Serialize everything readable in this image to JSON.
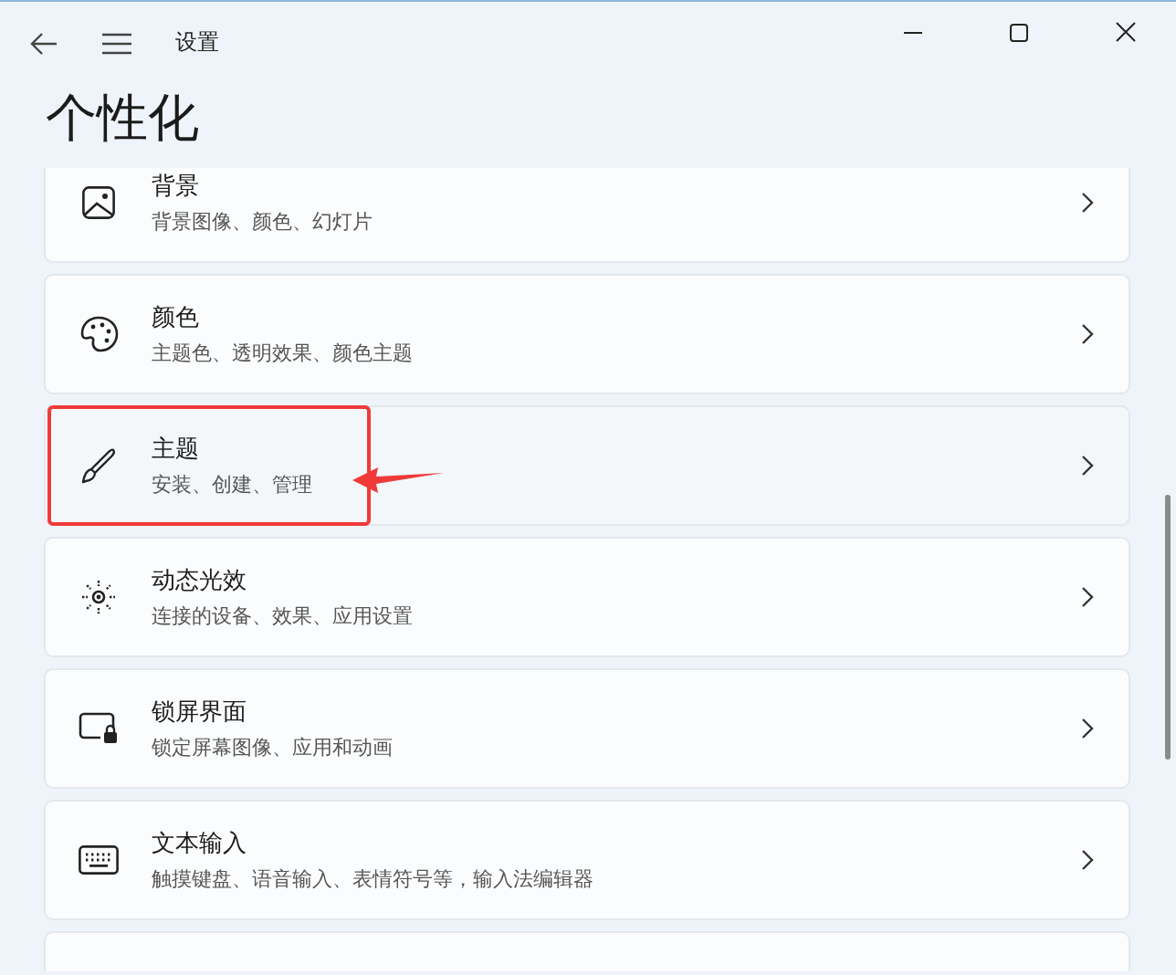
{
  "window": {
    "title": "设置"
  },
  "page_title": "个性化",
  "items": [
    {
      "kind": "picture",
      "title": "背景",
      "subtitle": "背景图像、颜色、幻灯片",
      "highlighted": false
    },
    {
      "kind": "palette",
      "title": "颜色",
      "subtitle": "主题色、透明效果、颜色主题",
      "highlighted": false
    },
    {
      "kind": "brush",
      "title": "主题",
      "subtitle": "安装、创建、管理",
      "highlighted": true
    },
    {
      "kind": "lighting",
      "title": "动态光效",
      "subtitle": "连接的设备、效果、应用设置",
      "highlighted": false
    },
    {
      "kind": "lockscreen",
      "title": "锁屏界面",
      "subtitle": "锁定屏幕图像、应用和动画",
      "highlighted": false
    },
    {
      "kind": "keyboard",
      "title": "文本输入",
      "subtitle": "触摸键盘、语音输入、表情符号等，输入法编辑器",
      "highlighted": false
    }
  ]
}
